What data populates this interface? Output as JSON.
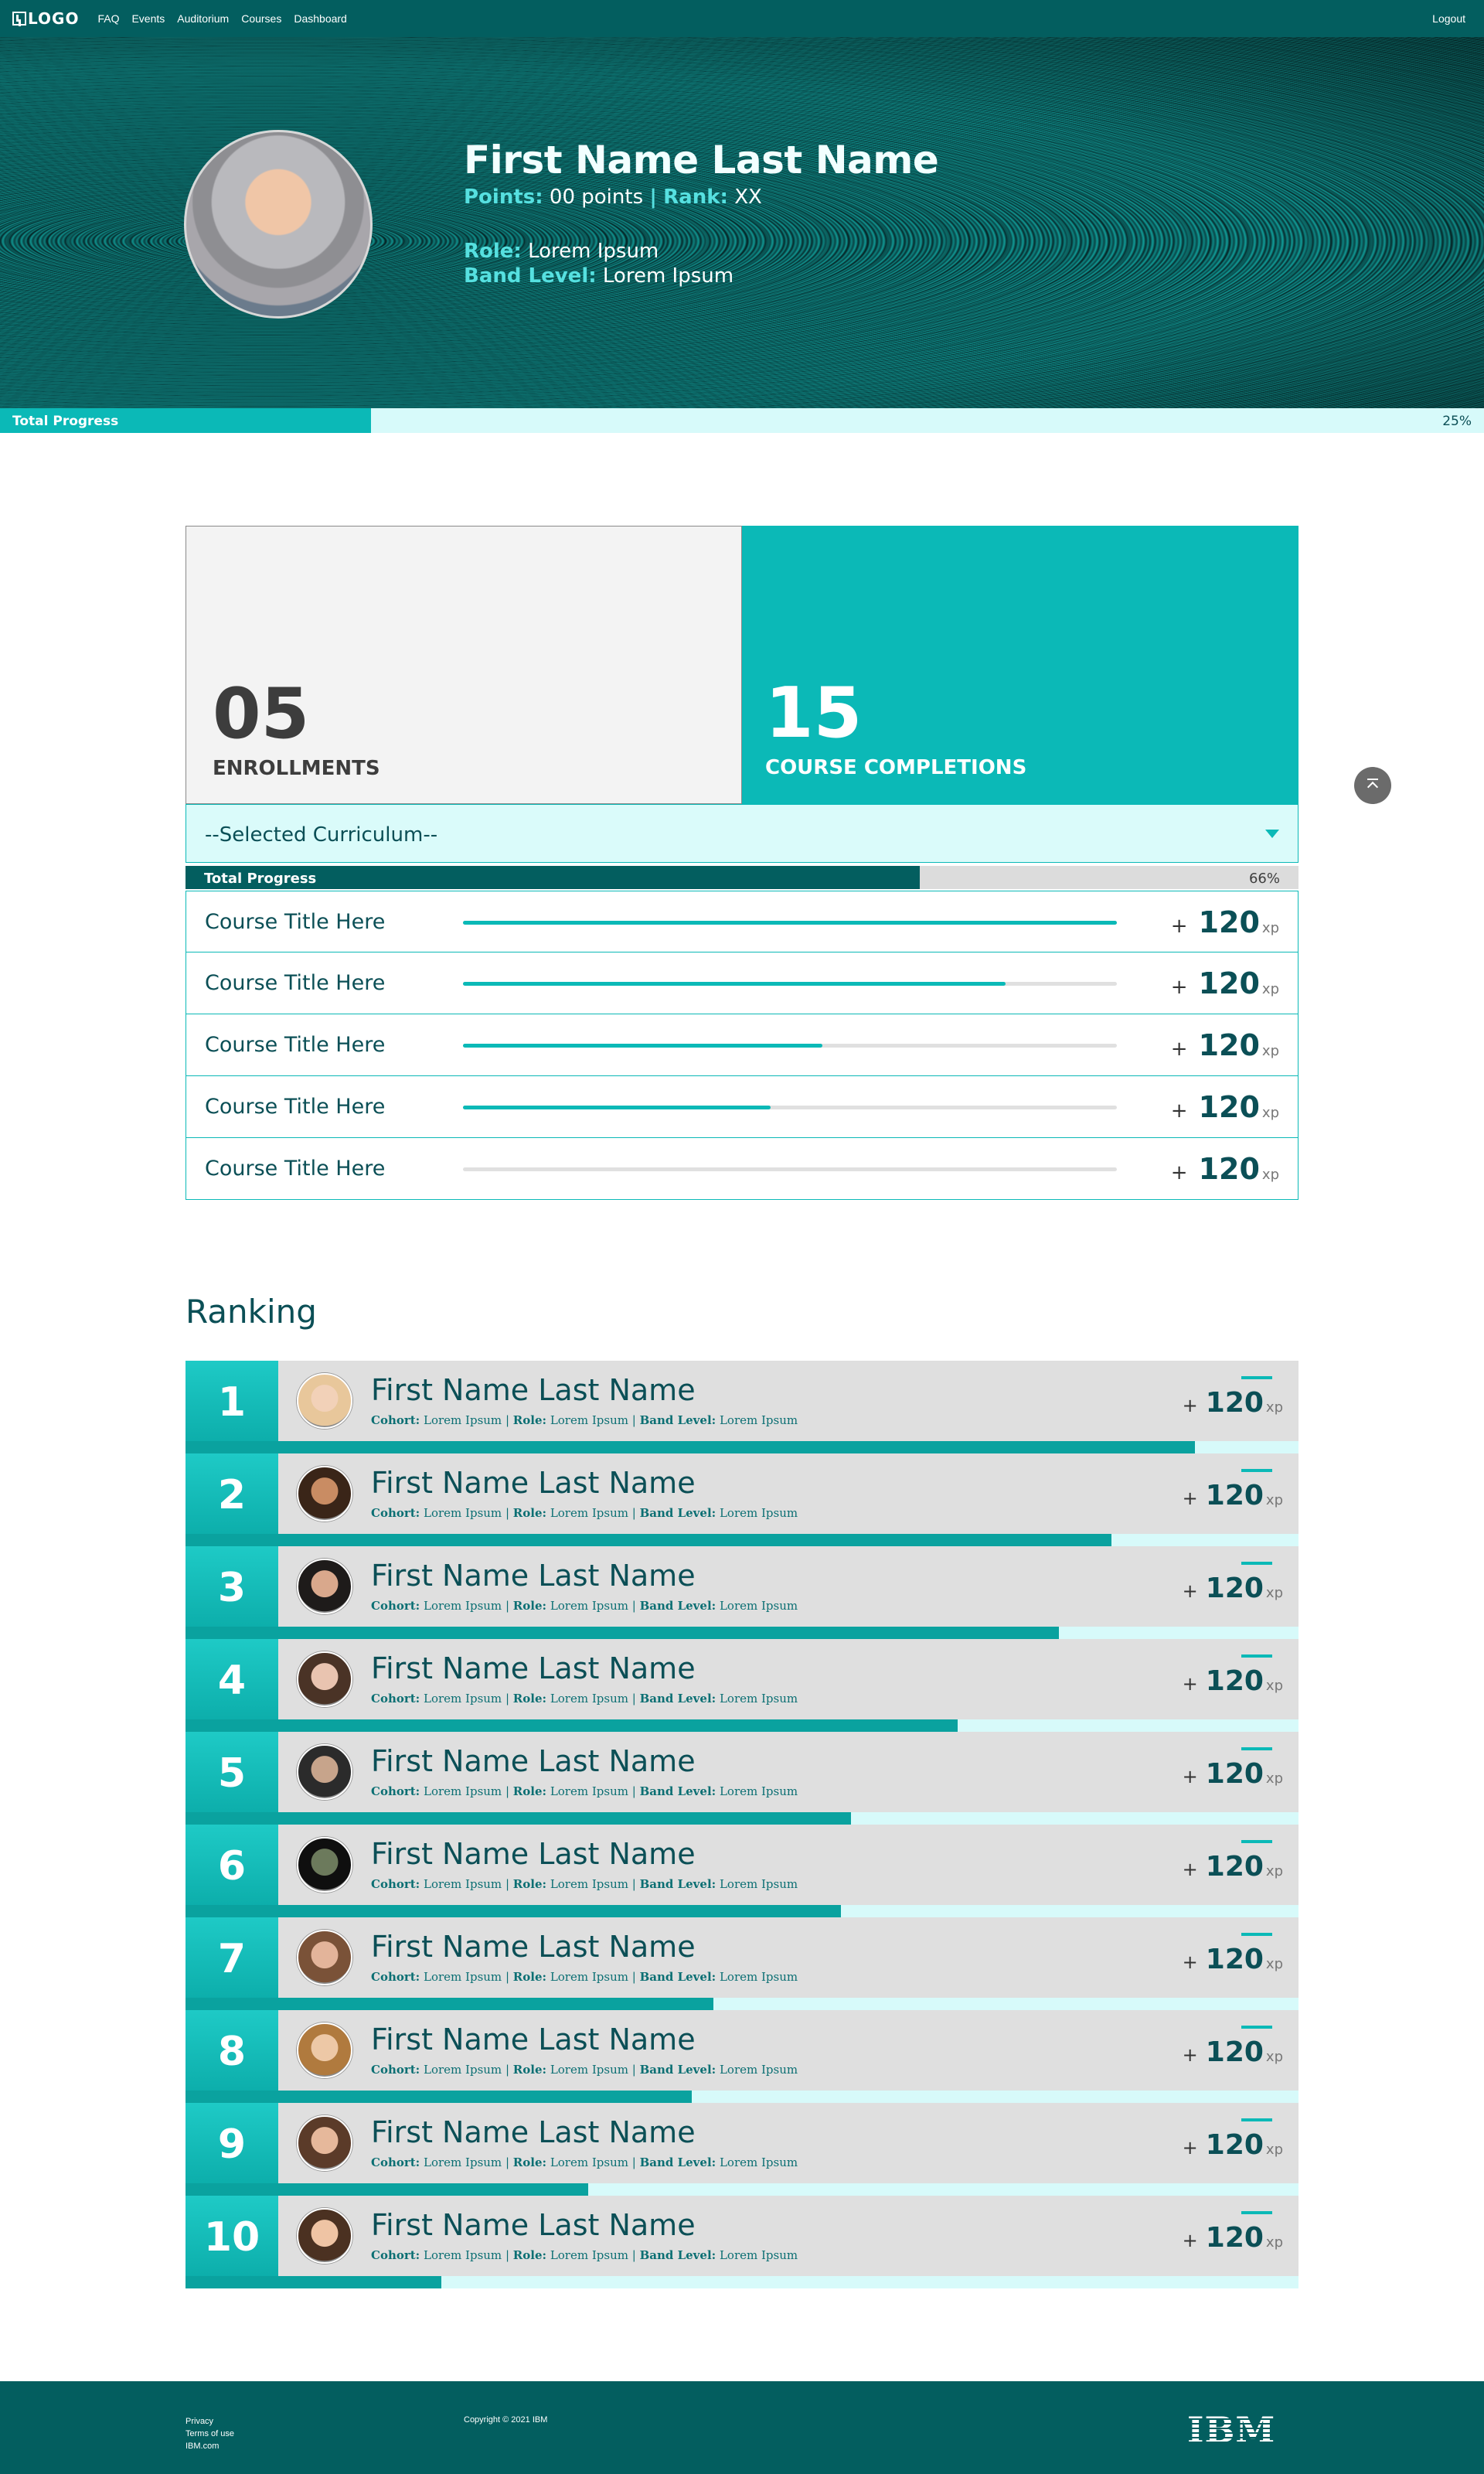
{
  "nav": {
    "logo": "LOGO",
    "links": [
      "FAQ",
      "Events",
      "Auditorium",
      "Courses",
      "Dashboard"
    ],
    "logout": "Logout"
  },
  "profile": {
    "name": "First Name Last Name",
    "points_label": "Points:",
    "points_value": "00 points",
    "separator": "|",
    "rank_label": "Rank:",
    "rank_value": "XX",
    "role_label": "Role:",
    "role_value": "Lorem Ipsum",
    "band_label": "Band Level:",
    "band_value": "Lorem Ipsum"
  },
  "total_progress": {
    "label": "Total Progress",
    "percent_text": "25%",
    "value": 0.25
  },
  "stats": {
    "enrollments_value": "05",
    "enrollments_label": "ENROLLMENTS",
    "completions_value": "15",
    "completions_label": "COURSE COMPLETIONS"
  },
  "curriculum": {
    "selected": "--Selected Curriculum--",
    "progress_label": "Total Progress",
    "progress_text": "66%",
    "progress_value": 0.66
  },
  "courses": [
    {
      "title": "Course Title Here",
      "progress": 1.0,
      "plus": "+",
      "xp": "120",
      "unit": "xp"
    },
    {
      "title": "Course Title Here",
      "progress": 0.83,
      "plus": "+",
      "xp": "120",
      "unit": "xp"
    },
    {
      "title": "Course Title Here",
      "progress": 0.55,
      "plus": "+",
      "xp": "120",
      "unit": "xp"
    },
    {
      "title": "Course Title Here",
      "progress": 0.47,
      "plus": "+",
      "xp": "120",
      "unit": "xp"
    },
    {
      "title": "Course Title Here",
      "progress": 0.0,
      "plus": "+",
      "xp": "120",
      "unit": "xp"
    }
  ],
  "ranking": {
    "title": "Ranking",
    "meta": {
      "cohort_label": "Cohort:",
      "role_label": "Role:",
      "band_label": "Band Level:",
      "sep": "|"
    },
    "entries": [
      {
        "rank": "1",
        "name": "First Name Last Name",
        "cohort": "Lorem Ipsum",
        "role": "Lorem Ipsum",
        "band": "Lorem Ipsum",
        "plus": "+",
        "xp": "120",
        "unit": "xp",
        "progress": 0.907,
        "avatar_colors": [
          "#e8c79b",
          "#f2d1b8"
        ]
      },
      {
        "rank": "2",
        "name": "First Name Last Name",
        "cohort": "Lorem Ipsum",
        "role": "Lorem Ipsum",
        "band": "Lorem Ipsum",
        "plus": "+",
        "xp": "120",
        "unit": "xp",
        "progress": 0.832,
        "avatar_colors": [
          "#3a2518",
          "#c98c63"
        ]
      },
      {
        "rank": "3",
        "name": "First Name Last Name",
        "cohort": "Lorem Ipsum",
        "role": "Lorem Ipsum",
        "band": "Lorem Ipsum",
        "plus": "+",
        "xp": "120",
        "unit": "xp",
        "progress": 0.785,
        "avatar_colors": [
          "#1e1b1a",
          "#d9a88c"
        ]
      },
      {
        "rank": "4",
        "name": "First Name Last Name",
        "cohort": "Lorem Ipsum",
        "role": "Lorem Ipsum",
        "band": "Lorem Ipsum",
        "plus": "+",
        "xp": "120",
        "unit": "xp",
        "progress": 0.694,
        "avatar_colors": [
          "#4a3326",
          "#e9c4b0"
        ]
      },
      {
        "rank": "5",
        "name": "First Name Last Name",
        "cohort": "Lorem Ipsum",
        "role": "Lorem Ipsum",
        "band": "Lorem Ipsum",
        "plus": "+",
        "xp": "120",
        "unit": "xp",
        "progress": 0.598,
        "avatar_colors": [
          "#2b2b2b",
          "#c7a48b"
        ]
      },
      {
        "rank": "6",
        "name": "First Name Last Name",
        "cohort": "Lorem Ipsum",
        "role": "Lorem Ipsum",
        "band": "Lorem Ipsum",
        "plus": "+",
        "xp": "120",
        "unit": "xp",
        "progress": 0.589,
        "avatar_colors": [
          "#0f0f0f",
          "#6c7a5c"
        ]
      },
      {
        "rank": "7",
        "name": "First Name Last Name",
        "cohort": "Lorem Ipsum",
        "role": "Lorem Ipsum",
        "band": "Lorem Ipsum",
        "plus": "+",
        "xp": "120",
        "unit": "xp",
        "progress": 0.474,
        "avatar_colors": [
          "#7a5238",
          "#e3b49a"
        ]
      },
      {
        "rank": "8",
        "name": "First Name Last Name",
        "cohort": "Lorem Ipsum",
        "role": "Lorem Ipsum",
        "band": "Lorem Ipsum",
        "plus": "+",
        "xp": "120",
        "unit": "xp",
        "progress": 0.455,
        "avatar_colors": [
          "#b07a3e",
          "#edc8a6"
        ]
      },
      {
        "rank": "9",
        "name": "First Name Last Name",
        "cohort": "Lorem Ipsum",
        "role": "Lorem Ipsum",
        "band": "Lorem Ipsum",
        "plus": "+",
        "xp": "120",
        "unit": "xp",
        "progress": 0.362,
        "avatar_colors": [
          "#5b3b29",
          "#e6b89b"
        ]
      },
      {
        "rank": "10",
        "name": "First Name Last Name",
        "cohort": "Lorem Ipsum",
        "role": "Lorem Ipsum",
        "band": "Lorem Ipsum",
        "plus": "+",
        "xp": "120",
        "unit": "xp",
        "progress": 0.23,
        "avatar_colors": [
          "#4b3121",
          "#efc4a4"
        ]
      }
    ]
  },
  "footer": {
    "links": [
      "Privacy",
      "Terms of use",
      "IBM.com"
    ],
    "copyright": "Copyright © 2021 IBM",
    "brand": "IBM."
  },
  "colors": {
    "brand_dark": "#035e5f",
    "accent": "#0bb9b7",
    "light_accent": "#d7fafa",
    "text_dark": "#0b4f56"
  },
  "icons": {
    "caret": "chevron-down-icon",
    "scroll_top": "arrow-up-to-top-icon"
  }
}
